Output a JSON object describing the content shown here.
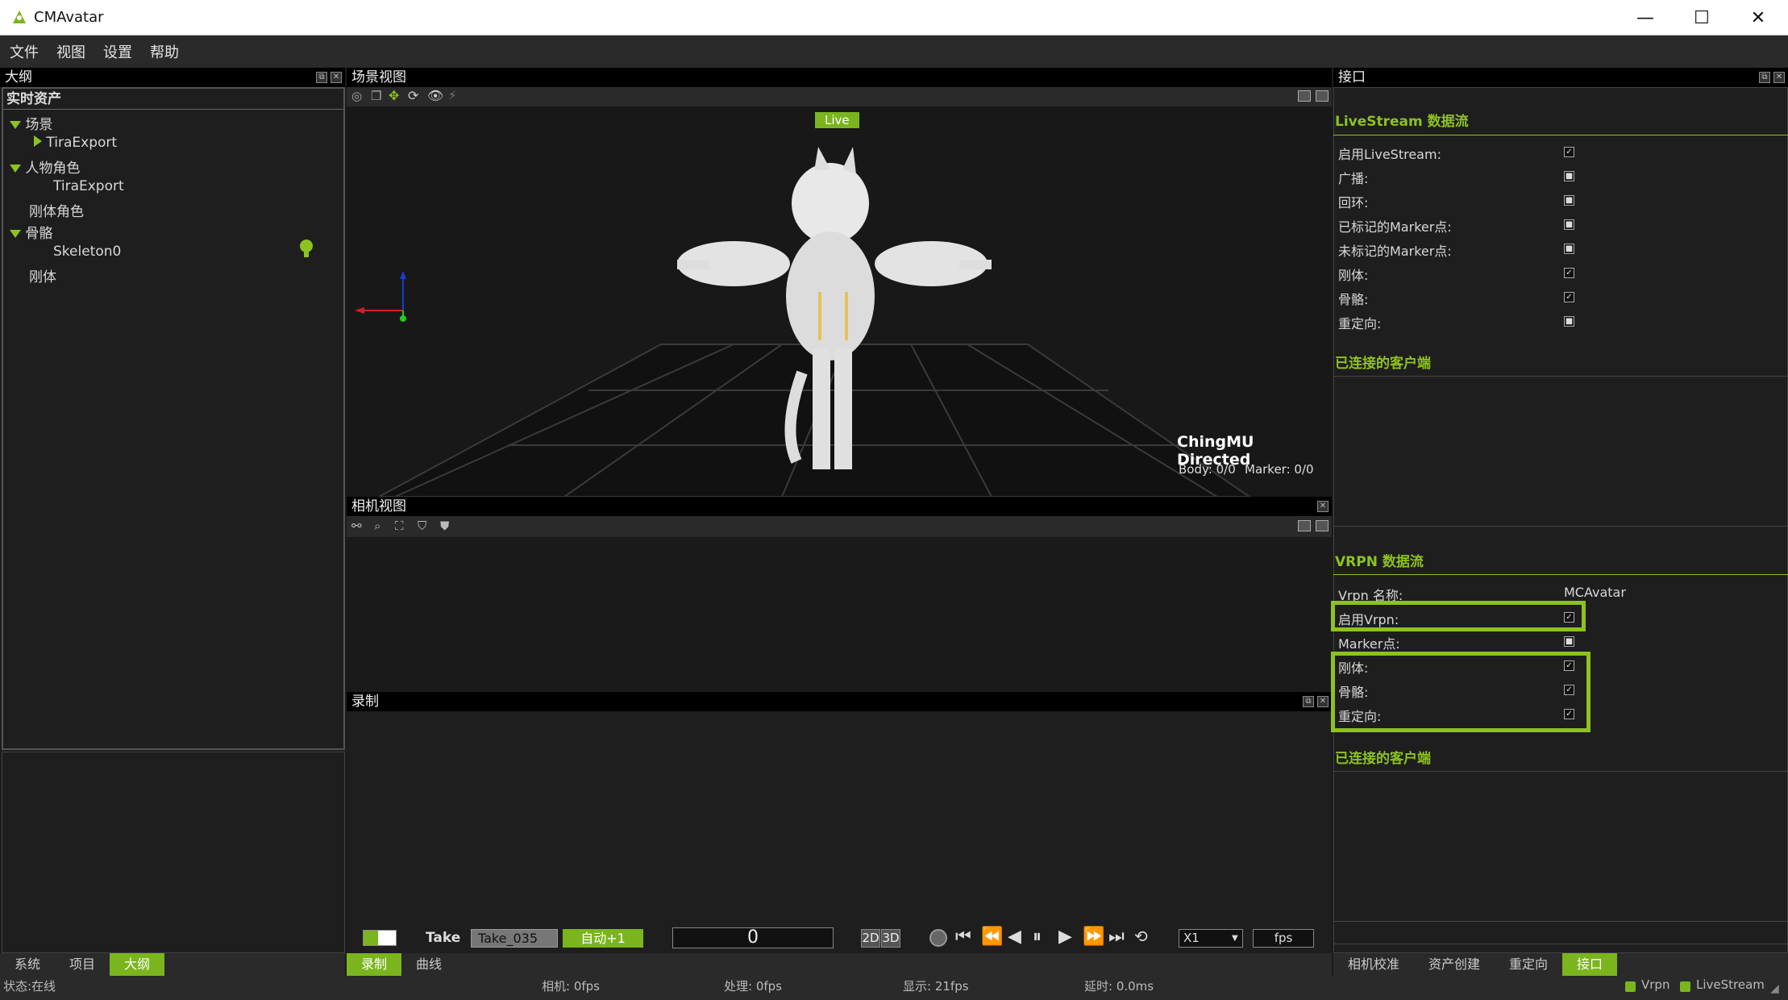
{
  "window": {
    "title": "CMAvatar",
    "minimize": "—",
    "maximize": "☐",
    "close": "✕"
  },
  "menu": [
    "文件",
    "视图",
    "设置",
    "帮助"
  ],
  "outline": {
    "title": "大纲",
    "header": "实时资产",
    "items": [
      {
        "label": "场景"
      },
      {
        "label": "TiraExport"
      },
      {
        "label": "人物角色"
      },
      {
        "label": "TiraExport"
      },
      {
        "label": "刚体角色"
      },
      {
        "label": "骨骼"
      },
      {
        "label": "Skeleton0"
      },
      {
        "label": "刚体"
      }
    ],
    "tabs": [
      "系统",
      "项目",
      "大纲"
    ]
  },
  "scene": {
    "title": "场景视图",
    "live": "Live",
    "brand": "ChingMU Directed",
    "body": "Body: 0/0",
    "marker": "Marker: 0/0"
  },
  "camera": {
    "title": "相机视图"
  },
  "record": {
    "title": "录制",
    "take_label": "Take",
    "take_value": "Take_035",
    "auto": "自动+1",
    "frame": "0",
    "mode2d": "2D",
    "mode3d": "3D",
    "speed": "X1",
    "fps": "fps",
    "tabs": [
      "录制",
      "曲线"
    ]
  },
  "interface": {
    "title": "接口",
    "livestream": {
      "title": "LiveStream 数据流",
      "rows": [
        "启用LiveStream:",
        "广播:",
        "回环:",
        "已标记的Marker点:",
        "未标记的Marker点:",
        "刚体:",
        "骨骼:",
        "重定向:"
      ],
      "checked": [
        true,
        false,
        false,
        false,
        false,
        true,
        true,
        false
      ],
      "clients": "已连接的客户端"
    },
    "vrpn": {
      "title": "VRPN 数据流",
      "name_label": "Vrpn 名称:",
      "name_value": "MCAvatar",
      "rows": [
        "启用Vrpn:",
        "Marker点:",
        "刚体:",
        "骨骼:",
        "重定向:"
      ],
      "checked": [
        true,
        false,
        true,
        true,
        true
      ],
      "clients": "已连接的客户端"
    },
    "tabs": [
      "相机校准",
      "资产创建",
      "重定向",
      "接口"
    ]
  },
  "status": {
    "state": "状态:在线",
    "camera": "相机: 0fps",
    "process": "处理: 0fps",
    "display": "显示: 21fps",
    "latency": "延时: 0.0ms",
    "vrpn": "Vrpn",
    "livestream": "LiveStream"
  },
  "colors": {
    "accent": "#8dc21f",
    "panel": "#1e1e1e",
    "header": "#000000"
  }
}
